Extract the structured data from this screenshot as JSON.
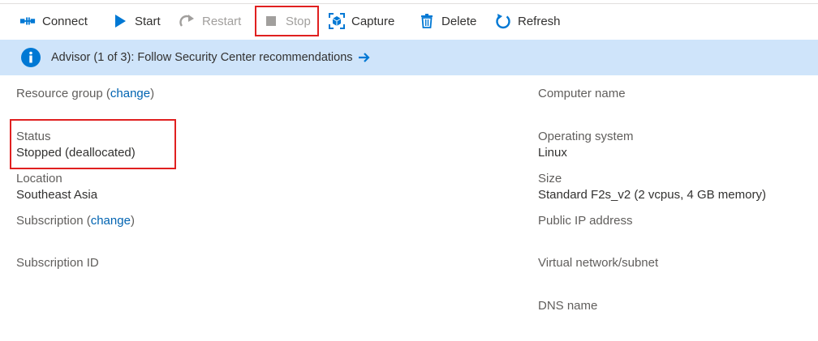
{
  "toolbar": {
    "items": [
      {
        "label": "Connect",
        "icon": "connect-icon"
      },
      {
        "label": "Start",
        "icon": "play-icon"
      },
      {
        "label": "Restart",
        "icon": "restart-icon",
        "disabled": true
      },
      {
        "label": "Stop",
        "icon": "stop-icon",
        "disabled": true
      },
      {
        "label": "Capture",
        "icon": "capture-icon"
      },
      {
        "label": "Delete",
        "icon": "trash-icon"
      },
      {
        "label": "Refresh",
        "icon": "refresh-icon"
      }
    ]
  },
  "banner": {
    "text": "Advisor (1 of 3): Follow Security Center recommendations",
    "icon": "info-icon",
    "arrow_icon": "arrow-right-icon"
  },
  "left": {
    "resource_group": {
      "label": "Resource group",
      "open": "(",
      "link": "change",
      "close": ")"
    },
    "status": {
      "label": "Status",
      "value": "Stopped (deallocated)"
    },
    "location": {
      "label": "Location",
      "value": "Southeast Asia"
    },
    "subscription": {
      "label": "Subscription",
      "open": "(",
      "link": "change",
      "close": ")"
    },
    "subscription_id": {
      "label": "Subscription ID"
    }
  },
  "right": {
    "computer_name": {
      "label": "Computer name"
    },
    "operating_system": {
      "label": "Operating system",
      "value": "Linux"
    },
    "size": {
      "label": "Size",
      "value": "Standard F2s_v2 (2 vcpus, 4 GB memory)"
    },
    "public_ip": {
      "label": "Public IP address"
    },
    "vnet": {
      "label": "Virtual network/subnet"
    },
    "dns": {
      "label": "DNS name"
    }
  },
  "colors": {
    "accent": "#0078d4",
    "banner_bg": "#cfe4fa",
    "highlight": "#e02020",
    "link": "#0063b1",
    "disabled": "#a19f9d"
  }
}
